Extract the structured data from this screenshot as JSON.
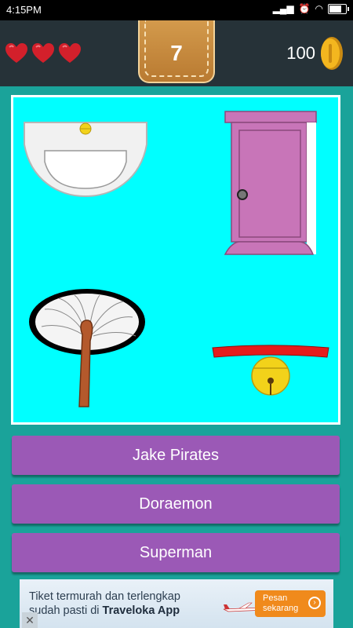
{
  "status_bar": {
    "time": "4:15PM"
  },
  "header": {
    "lives": 3,
    "level": "7",
    "coins": "100",
    "colors": {
      "background": "#263238",
      "heart": "#d3202b",
      "coin": "#f3b61f"
    }
  },
  "picture_panel": {
    "items": [
      "sink-icon",
      "door-icon",
      "hand-fan-icon",
      "bell-collar-icon"
    ],
    "background": "#00ffff"
  },
  "answers": [
    {
      "label": "Jake Pirates"
    },
    {
      "label": "Doraemon"
    },
    {
      "label": "Superman"
    }
  ],
  "ad": {
    "line1": "Tiket termurah dan terlengkap",
    "line2_prefix": "sudah pasti di ",
    "line2_brand": "Traveloka App",
    "cta_line1": "Pesan",
    "cta_line2": "sekarang",
    "close": "✕"
  },
  "colors": {
    "app_background": "#1aa39a",
    "button": "#9b59b6"
  }
}
